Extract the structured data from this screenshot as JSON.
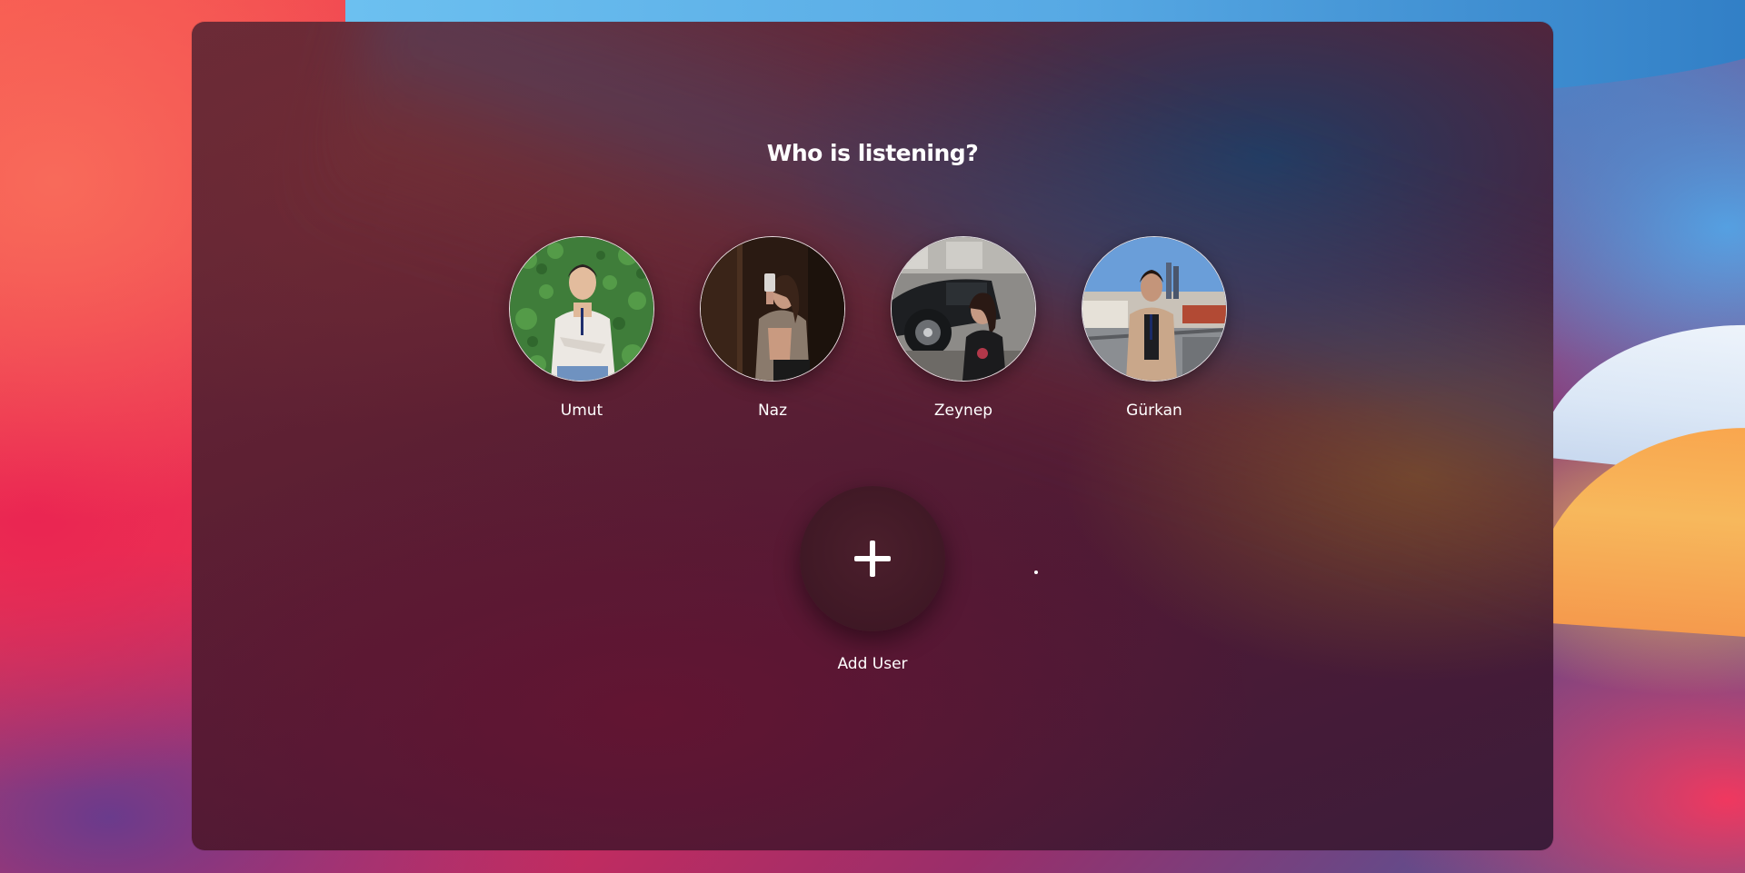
{
  "header": {
    "title": "Who is listening?"
  },
  "profiles": [
    {
      "name": "Umut",
      "avatar_icon": "user-photo-icon"
    },
    {
      "name": "Naz",
      "avatar_icon": "user-photo-icon"
    },
    {
      "name": "Zeynep",
      "avatar_icon": "user-photo-icon"
    },
    {
      "name": "Gürkan",
      "avatar_icon": "user-photo-icon"
    }
  ],
  "add_user": {
    "label": "Add User",
    "icon": "plus-icon"
  },
  "colors": {
    "panel_tint": "#5e2033",
    "text": "#ffffff",
    "add_button": "#3f1825"
  }
}
